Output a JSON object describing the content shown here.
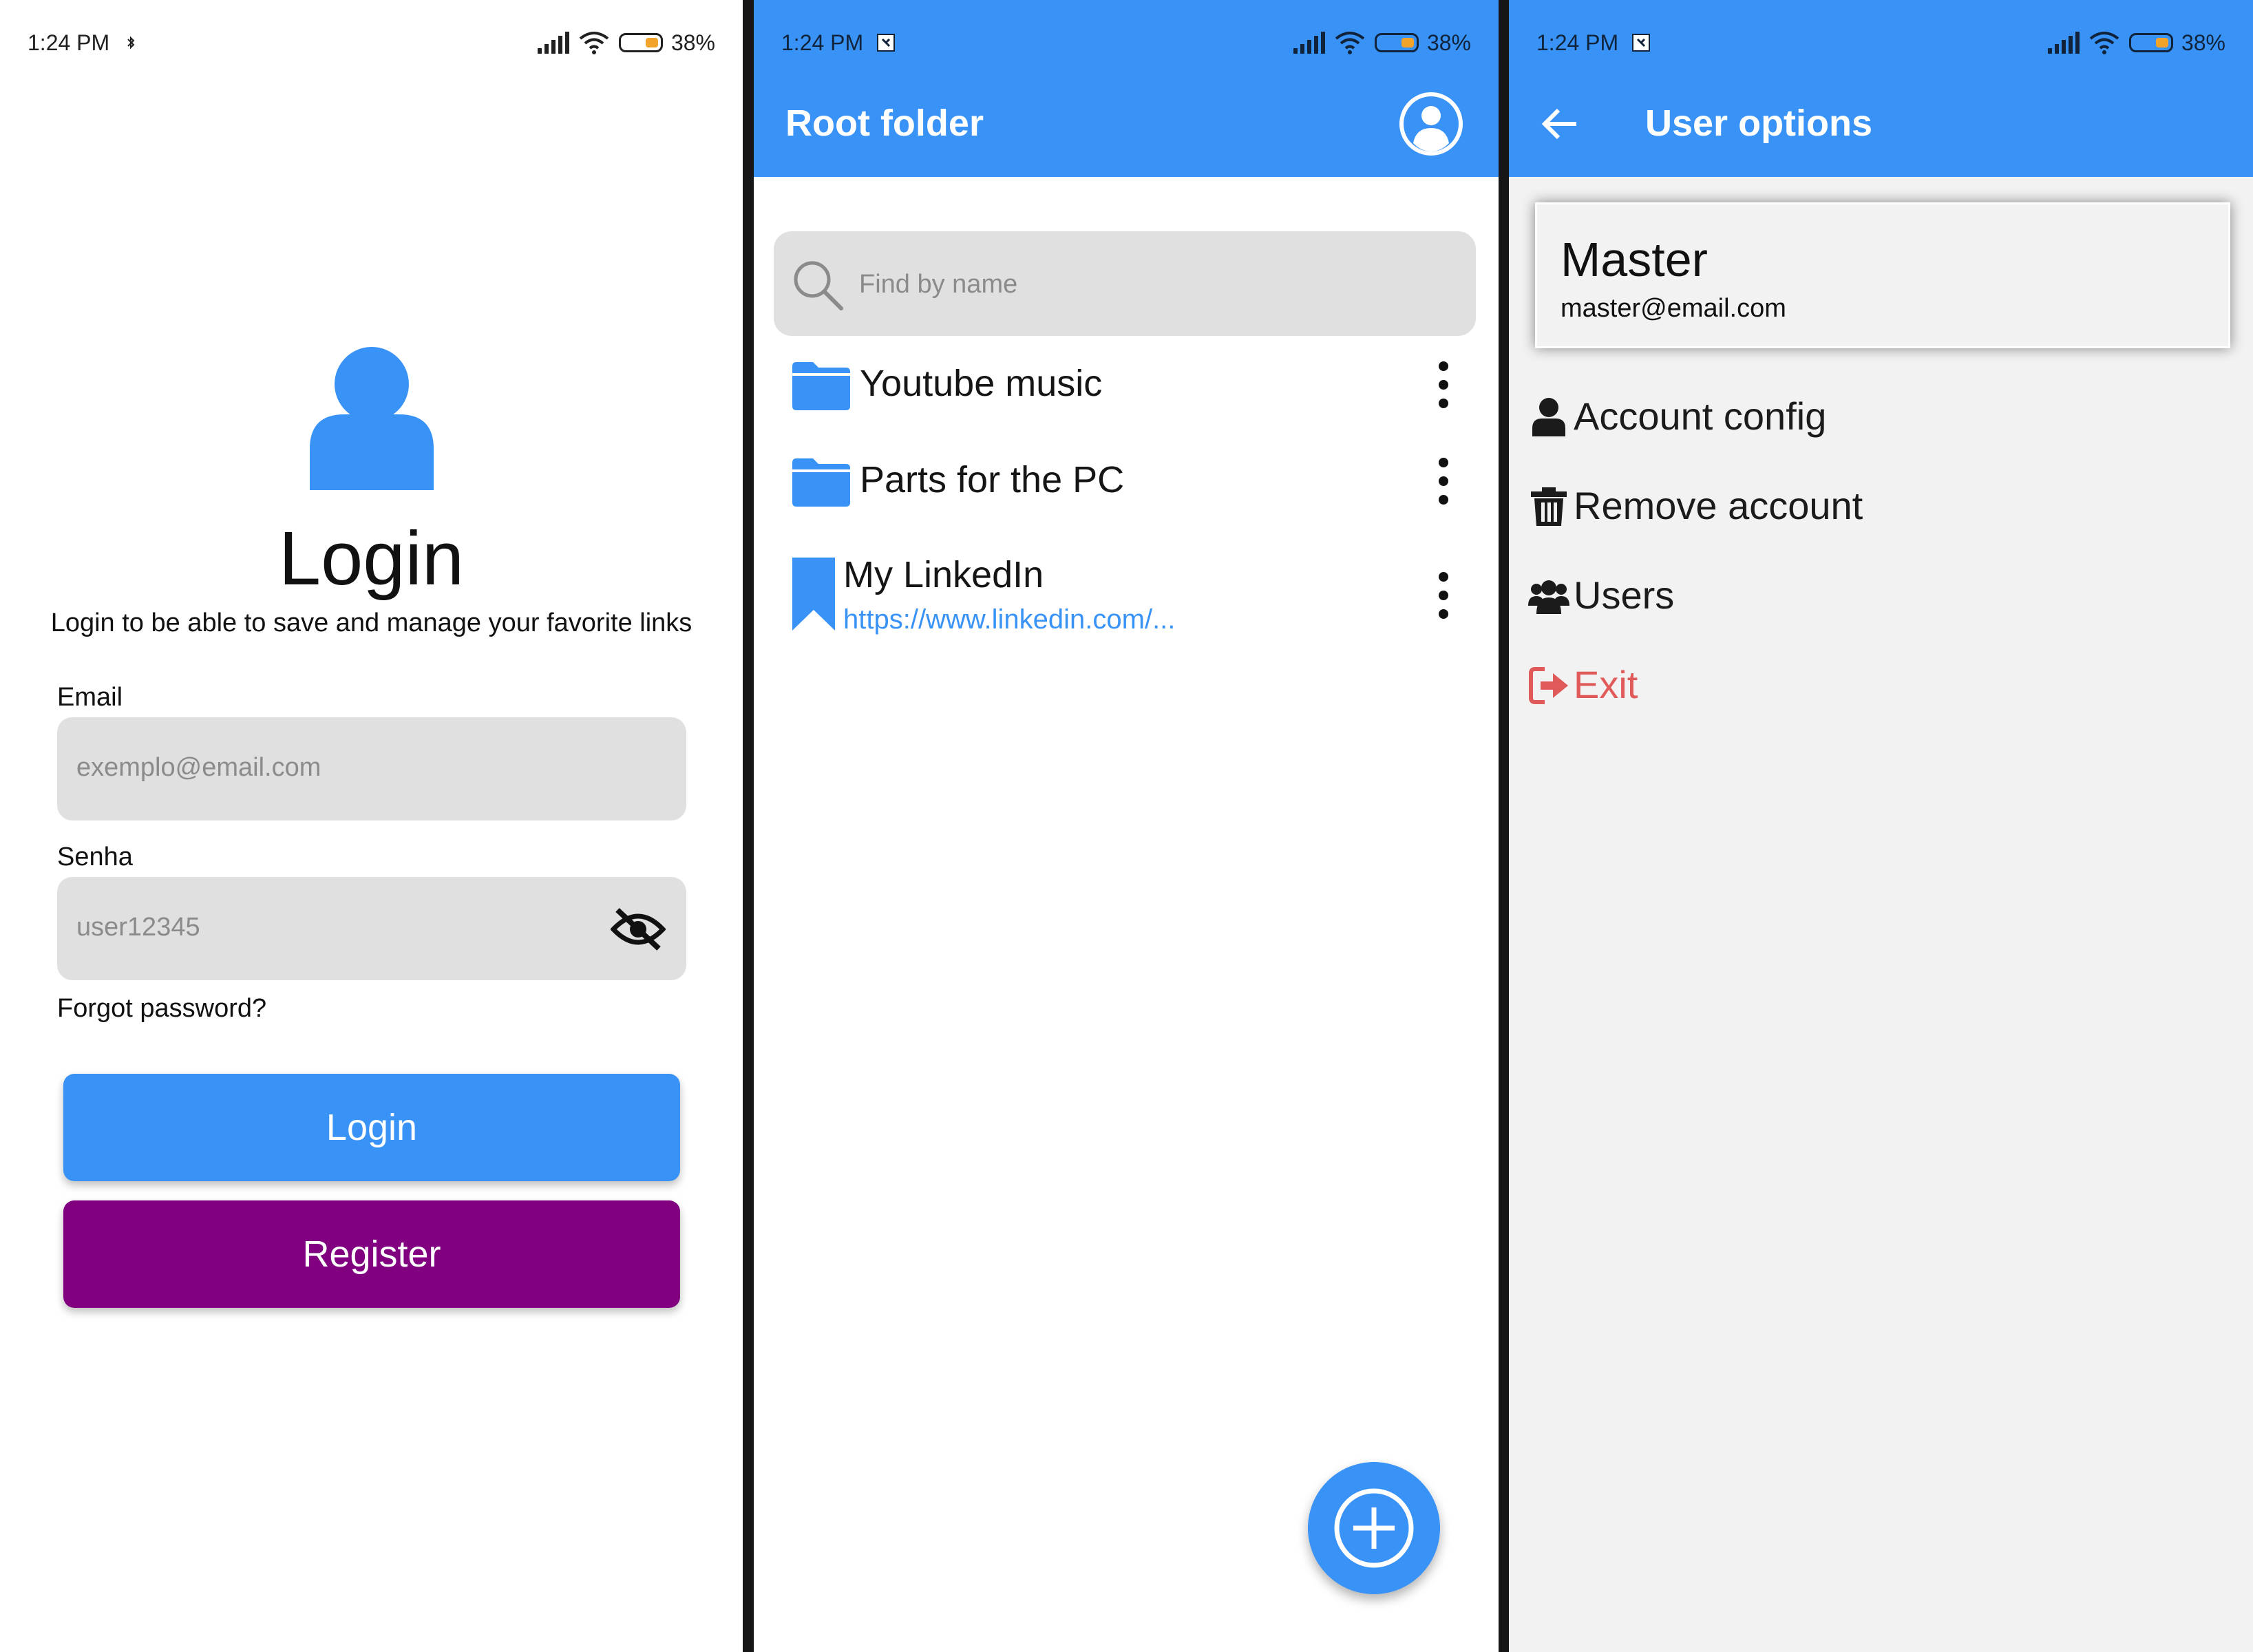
{
  "status_bar": {
    "time": "1:24 PM",
    "battery_pct": "38%"
  },
  "login_screen": {
    "title": "Login",
    "subtitle": "Login to be able to save and manage your favorite links",
    "email_label": "Email",
    "email_placeholder": "exemplo@email.com",
    "password_label": "Senha",
    "password_value": "user12345",
    "forgot_password": "Forgot password?",
    "login_button": "Login",
    "register_button": "Register",
    "colors": {
      "primary": "#3993f7",
      "register": "#800080"
    }
  },
  "folder_screen": {
    "title": "Root folder",
    "search_placeholder": "Find by name",
    "items": [
      {
        "type": "folder",
        "name": "Youtube music"
      },
      {
        "type": "folder",
        "name": "Parts for the PC"
      },
      {
        "type": "link",
        "name": "My LinkedIn",
        "url": "https://www.linkedin.com/..."
      }
    ]
  },
  "user_options_screen": {
    "title": "User options",
    "user_name": "Master",
    "user_email": "master@email.com",
    "options": [
      {
        "label": "Account config",
        "icon": "user-icon"
      },
      {
        "label": "Remove account",
        "icon": "trash-icon"
      },
      {
        "label": "Users",
        "icon": "users-icon"
      },
      {
        "label": "Exit",
        "icon": "sign-out-icon",
        "color": "#e05a5a"
      }
    ]
  }
}
